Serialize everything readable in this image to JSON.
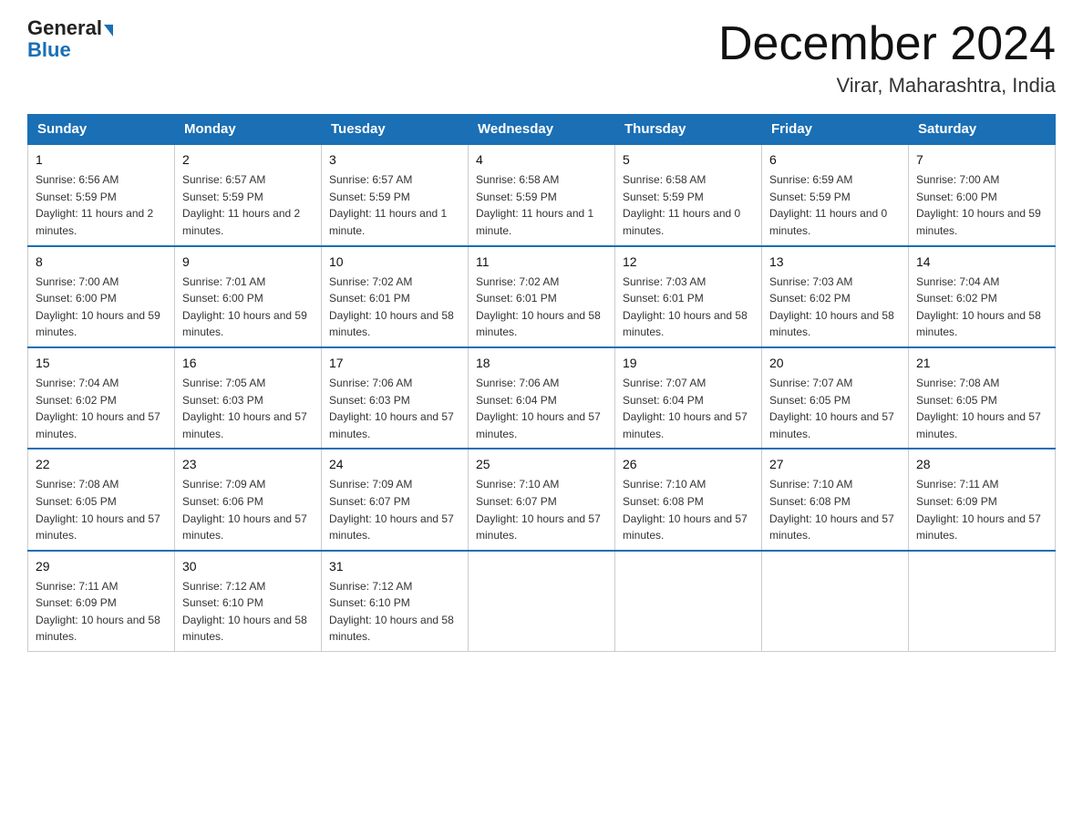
{
  "header": {
    "logo_general": "General",
    "logo_blue": "Blue",
    "month_title": "December 2024",
    "location": "Virar, Maharashtra, India"
  },
  "weekdays": [
    "Sunday",
    "Monday",
    "Tuesday",
    "Wednesday",
    "Thursday",
    "Friday",
    "Saturday"
  ],
  "weeks": [
    [
      {
        "day": "1",
        "sunrise": "6:56 AM",
        "sunset": "5:59 PM",
        "daylight": "11 hours and 2 minutes."
      },
      {
        "day": "2",
        "sunrise": "6:57 AM",
        "sunset": "5:59 PM",
        "daylight": "11 hours and 2 minutes."
      },
      {
        "day": "3",
        "sunrise": "6:57 AM",
        "sunset": "5:59 PM",
        "daylight": "11 hours and 1 minute."
      },
      {
        "day": "4",
        "sunrise": "6:58 AM",
        "sunset": "5:59 PM",
        "daylight": "11 hours and 1 minute."
      },
      {
        "day": "5",
        "sunrise": "6:58 AM",
        "sunset": "5:59 PM",
        "daylight": "11 hours and 0 minutes."
      },
      {
        "day": "6",
        "sunrise": "6:59 AM",
        "sunset": "5:59 PM",
        "daylight": "11 hours and 0 minutes."
      },
      {
        "day": "7",
        "sunrise": "7:00 AM",
        "sunset": "6:00 PM",
        "daylight": "10 hours and 59 minutes."
      }
    ],
    [
      {
        "day": "8",
        "sunrise": "7:00 AM",
        "sunset": "6:00 PM",
        "daylight": "10 hours and 59 minutes."
      },
      {
        "day": "9",
        "sunrise": "7:01 AM",
        "sunset": "6:00 PM",
        "daylight": "10 hours and 59 minutes."
      },
      {
        "day": "10",
        "sunrise": "7:02 AM",
        "sunset": "6:01 PM",
        "daylight": "10 hours and 58 minutes."
      },
      {
        "day": "11",
        "sunrise": "7:02 AM",
        "sunset": "6:01 PM",
        "daylight": "10 hours and 58 minutes."
      },
      {
        "day": "12",
        "sunrise": "7:03 AM",
        "sunset": "6:01 PM",
        "daylight": "10 hours and 58 minutes."
      },
      {
        "day": "13",
        "sunrise": "7:03 AM",
        "sunset": "6:02 PM",
        "daylight": "10 hours and 58 minutes."
      },
      {
        "day": "14",
        "sunrise": "7:04 AM",
        "sunset": "6:02 PM",
        "daylight": "10 hours and 58 minutes."
      }
    ],
    [
      {
        "day": "15",
        "sunrise": "7:04 AM",
        "sunset": "6:02 PM",
        "daylight": "10 hours and 57 minutes."
      },
      {
        "day": "16",
        "sunrise": "7:05 AM",
        "sunset": "6:03 PM",
        "daylight": "10 hours and 57 minutes."
      },
      {
        "day": "17",
        "sunrise": "7:06 AM",
        "sunset": "6:03 PM",
        "daylight": "10 hours and 57 minutes."
      },
      {
        "day": "18",
        "sunrise": "7:06 AM",
        "sunset": "6:04 PM",
        "daylight": "10 hours and 57 minutes."
      },
      {
        "day": "19",
        "sunrise": "7:07 AM",
        "sunset": "6:04 PM",
        "daylight": "10 hours and 57 minutes."
      },
      {
        "day": "20",
        "sunrise": "7:07 AM",
        "sunset": "6:05 PM",
        "daylight": "10 hours and 57 minutes."
      },
      {
        "day": "21",
        "sunrise": "7:08 AM",
        "sunset": "6:05 PM",
        "daylight": "10 hours and 57 minutes."
      }
    ],
    [
      {
        "day": "22",
        "sunrise": "7:08 AM",
        "sunset": "6:05 PM",
        "daylight": "10 hours and 57 minutes."
      },
      {
        "day": "23",
        "sunrise": "7:09 AM",
        "sunset": "6:06 PM",
        "daylight": "10 hours and 57 minutes."
      },
      {
        "day": "24",
        "sunrise": "7:09 AM",
        "sunset": "6:07 PM",
        "daylight": "10 hours and 57 minutes."
      },
      {
        "day": "25",
        "sunrise": "7:10 AM",
        "sunset": "6:07 PM",
        "daylight": "10 hours and 57 minutes."
      },
      {
        "day": "26",
        "sunrise": "7:10 AM",
        "sunset": "6:08 PM",
        "daylight": "10 hours and 57 minutes."
      },
      {
        "day": "27",
        "sunrise": "7:10 AM",
        "sunset": "6:08 PM",
        "daylight": "10 hours and 57 minutes."
      },
      {
        "day": "28",
        "sunrise": "7:11 AM",
        "sunset": "6:09 PM",
        "daylight": "10 hours and 57 minutes."
      }
    ],
    [
      {
        "day": "29",
        "sunrise": "7:11 AM",
        "sunset": "6:09 PM",
        "daylight": "10 hours and 58 minutes."
      },
      {
        "day": "30",
        "sunrise": "7:12 AM",
        "sunset": "6:10 PM",
        "daylight": "10 hours and 58 minutes."
      },
      {
        "day": "31",
        "sunrise": "7:12 AM",
        "sunset": "6:10 PM",
        "daylight": "10 hours and 58 minutes."
      },
      null,
      null,
      null,
      null
    ]
  ]
}
